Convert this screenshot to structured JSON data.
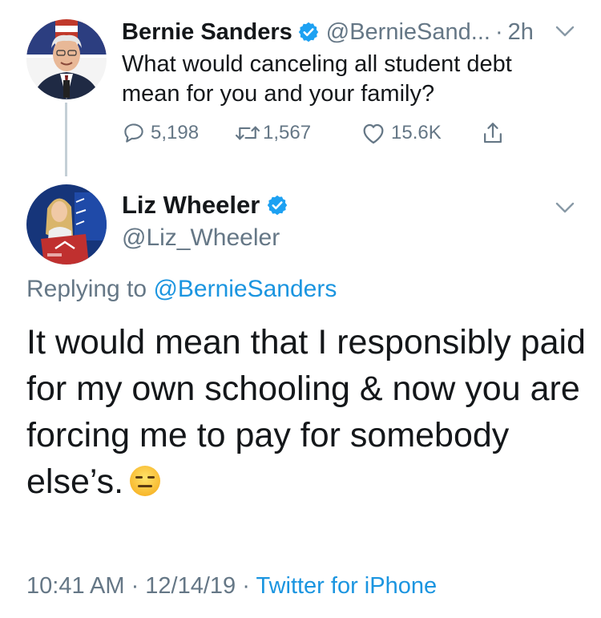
{
  "parent_tweet": {
    "author_name": "Bernie Sanders",
    "handle": "@BernieSand...",
    "separator": "·",
    "time": "2h",
    "text": "What would canceling all student debt mean for you and your family?",
    "replies": "5,198",
    "retweets": "1,567",
    "likes": "15.6K",
    "avatar_icon": "bernie-sanders-avatar",
    "verified_icon": "verified-badge-icon"
  },
  "reply_tweet": {
    "author_name": "Liz Wheeler",
    "handle": "@Liz_Wheeler",
    "replying_prefix": "Replying to",
    "replying_to": "@BernieSanders",
    "text": "It would mean that I responsibly paid for my own schooling & now you are forcing me to pay for somebody else’s.",
    "emoji": "expressionless-face",
    "timestamp": "10:41 AM · 12/14/19 · ",
    "source": "Twitter for iPhone",
    "avatar_icon": "liz-wheeler-avatar"
  },
  "colors": {
    "text": "#14171a",
    "muted": "#657786",
    "link": "#1b95e0",
    "verified": "#1da1f2",
    "thread_line": "#c4cfd6"
  }
}
